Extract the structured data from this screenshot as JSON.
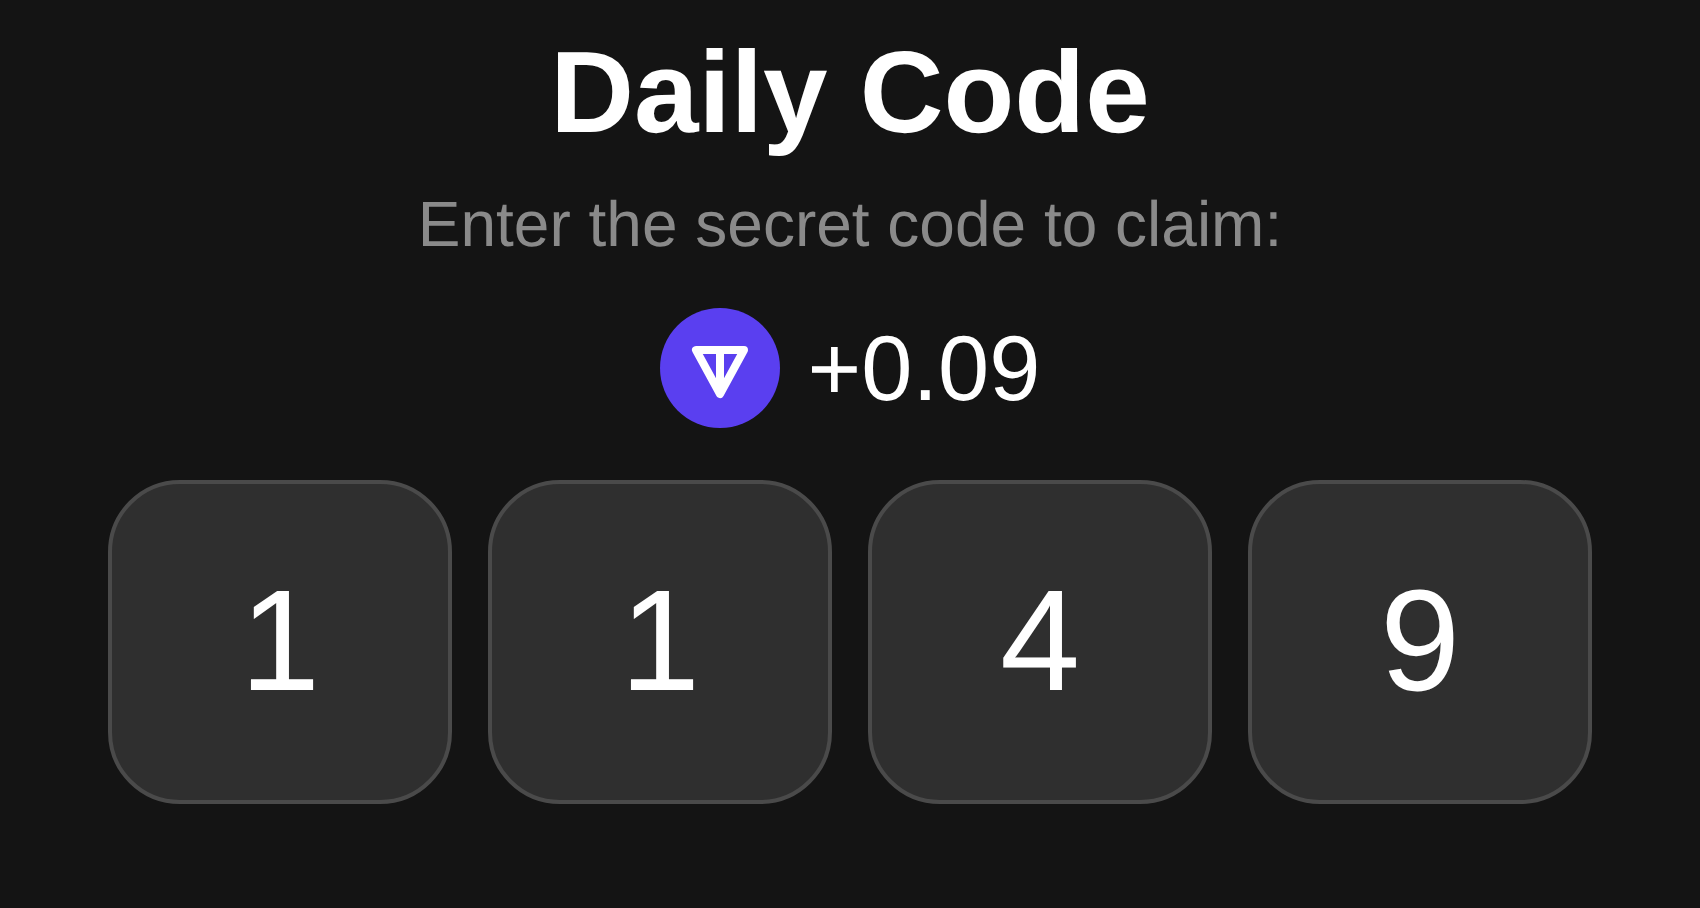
{
  "title": "Daily Code",
  "subtitle": "Enter the secret code to claim:",
  "reward": {
    "amount": "+0.09"
  },
  "code_digits": [
    "1",
    "1",
    "4",
    "9"
  ]
}
